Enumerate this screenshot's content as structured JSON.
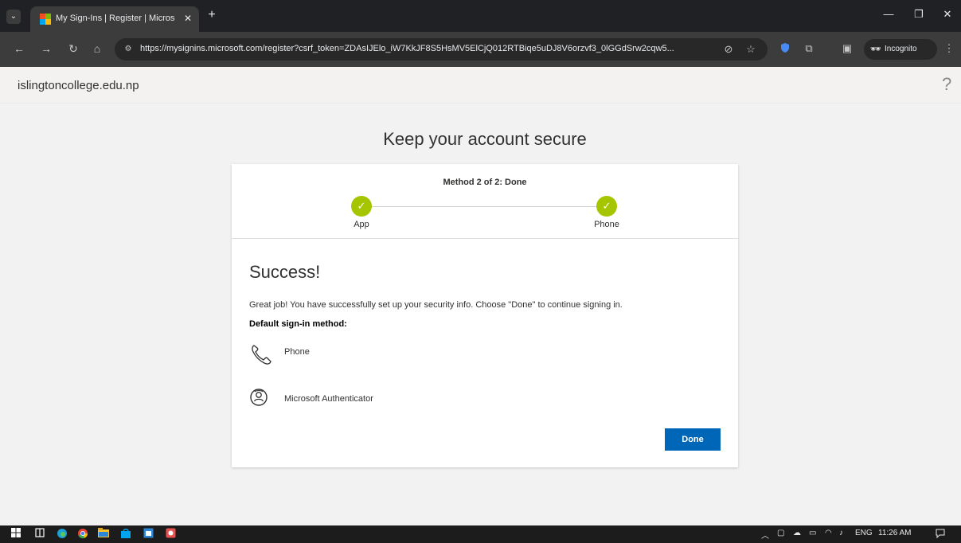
{
  "browser": {
    "tab_title": "My Sign-Ins | Register | Microso",
    "url": "https://mysignins.microsoft.com/register?csrf_token=ZDAsIJElo_iW7KkJF8S5HsMV5ElCjQ012RTBiqe5uDJ8V6orzvf3_0lGGdSrw2cqw5...",
    "incognito_label": "Incognito",
    "new_tab_symbol": "+",
    "tab_close_symbol": "✕"
  },
  "icons": {
    "back": "←",
    "forward": "→",
    "reload": "↻",
    "home": "⌂",
    "site_info": "⚙",
    "eye_off": "⊘",
    "star": "☆",
    "extension": "⧉",
    "sidepanel": "▣",
    "menu": "⋮",
    "minimize": "—",
    "restore": "❐",
    "close": "✕",
    "tab_search": "⌄",
    "incognito": "🕶",
    "check": "✓"
  },
  "page": {
    "domain": "islingtoncollege.edu.np",
    "help_symbol": "?",
    "headline": "Keep your account secure"
  },
  "card": {
    "step_title": "Method 2 of 2: Done",
    "steps": [
      {
        "label": "App"
      },
      {
        "label": "Phone"
      }
    ],
    "success_title": "Success!",
    "description": "Great job! You have successfully set up your security info. Choose \"Done\" to continue signing in.",
    "default_label": "Default sign-in method:",
    "methods": [
      {
        "label": "Phone",
        "icon": "phone-icon"
      },
      {
        "label": "Microsoft Authenticator",
        "icon": "authenticator-icon"
      }
    ],
    "done_label": "Done"
  },
  "taskbar": {
    "tray_text": "ENG",
    "time": "11:26 AM"
  },
  "colors": {
    "accent": "#0067b8",
    "check_green": "#a5c500",
    "chrome_dark": "#202124"
  }
}
